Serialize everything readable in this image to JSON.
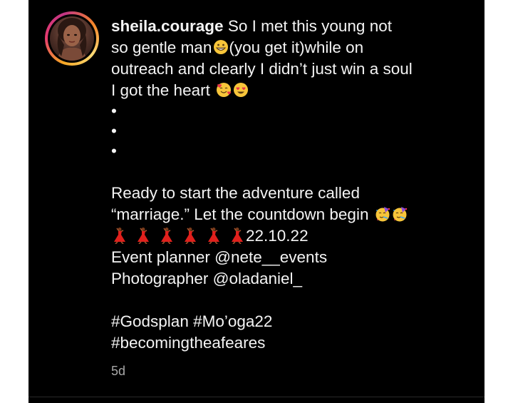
{
  "post": {
    "username": "sheila.courage",
    "caption_lines": [
      "So I met this young not",
      "so gentle man",
      "(you get it)while on",
      "outreach and clearly I didn’t just win a soul",
      "I got the heart"
    ],
    "bullets": [
      "•",
      "•",
      "•"
    ],
    "announce_lines": [
      "Ready to start the adventure called",
      "“marriage.” Let the countdown begin"
    ],
    "date": "22.10.22",
    "event_planner_label": "Event planner",
    "event_planner_handle": "@nete__events",
    "photographer_label": "Photographer",
    "photographer_handle": "@oladaniel_",
    "hashtags_line1": "#Godsplan #Mo’oga22",
    "hashtags_line2": "#becomingtheafeares",
    "timestamp": "5d"
  },
  "icons": {
    "grin": "grinning-face-emoji",
    "hearts_face": "smiling-face-with-hearts-emoji",
    "heart_eyes": "heart-eyes-emoji",
    "party": "partying-face-emoji",
    "dancer": "dancing-woman-emoji"
  },
  "colors": {
    "background": "#000000",
    "text": "#f4f4f4",
    "timestamp": "#a8a8a8"
  }
}
